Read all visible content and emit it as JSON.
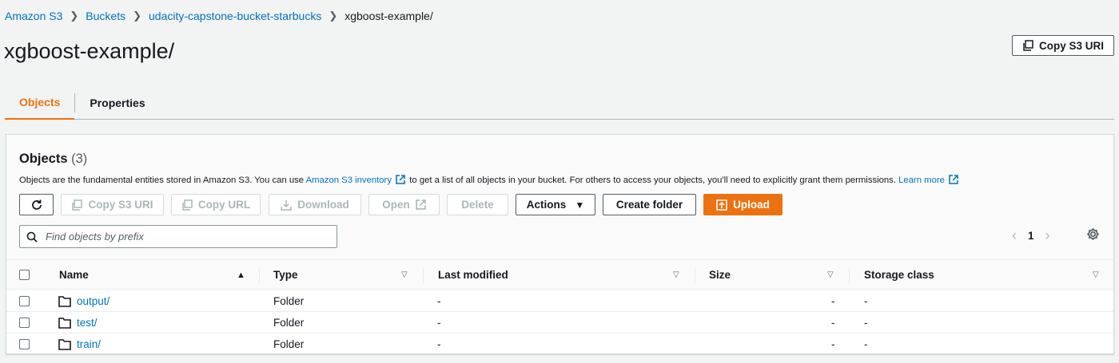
{
  "breadcrumb": {
    "items": [
      "Amazon S3",
      "Buckets",
      "udacity-capstone-bucket-starbucks"
    ],
    "current": "xgboost-example/"
  },
  "page_title": "xgboost-example/",
  "header_actions": {
    "copy_s3_uri": "Copy S3 URI"
  },
  "tabs": [
    {
      "label": "Objects",
      "active": true
    },
    {
      "label": "Properties",
      "active": false
    }
  ],
  "objects_panel": {
    "title": "Objects",
    "count": "(3)",
    "description_before": "Objects are the fundamental entities stored in Amazon S3. You can use ",
    "inventory_link": "Amazon S3 inventory",
    "description_after": " to get a list of all objects in your bucket. For others to access your objects, you'll need to explicitly grant them permissions.",
    "learn_more": "Learn more",
    "toolbar": {
      "copy_s3_uri": "Copy S3 URI",
      "copy_url": "Copy URL",
      "download": "Download",
      "open": "Open",
      "delete": "Delete",
      "actions": "Actions",
      "create_folder": "Create folder",
      "upload": "Upload"
    },
    "search": {
      "placeholder": "Find objects by prefix"
    },
    "pagination": {
      "current_page": "1"
    }
  },
  "table": {
    "columns": [
      "Name",
      "Type",
      "Last modified",
      "Size",
      "Storage class"
    ],
    "rows": [
      {
        "name": "output/",
        "type": "Folder",
        "last_modified": "-",
        "size": "-",
        "storage_class": "-"
      },
      {
        "name": "test/",
        "type": "Folder",
        "last_modified": "-",
        "size": "-",
        "storage_class": "-"
      },
      {
        "name": "train/",
        "type": "Folder",
        "last_modified": "-",
        "size": "-",
        "storage_class": "-"
      }
    ]
  },
  "colors": {
    "accent": "#ec7211",
    "link": "#0073bb",
    "background": "#f2f3f3",
    "disabled": "#aab7b8"
  },
  "icons": [
    "chevron-right-icon",
    "copy-icon",
    "refresh-icon",
    "download-icon",
    "external-link-icon",
    "caret-down-icon",
    "upload-icon",
    "search-icon",
    "chevron-left-icon",
    "gear-icon",
    "sort-ascending-icon",
    "sort-icon",
    "folder-icon"
  ]
}
